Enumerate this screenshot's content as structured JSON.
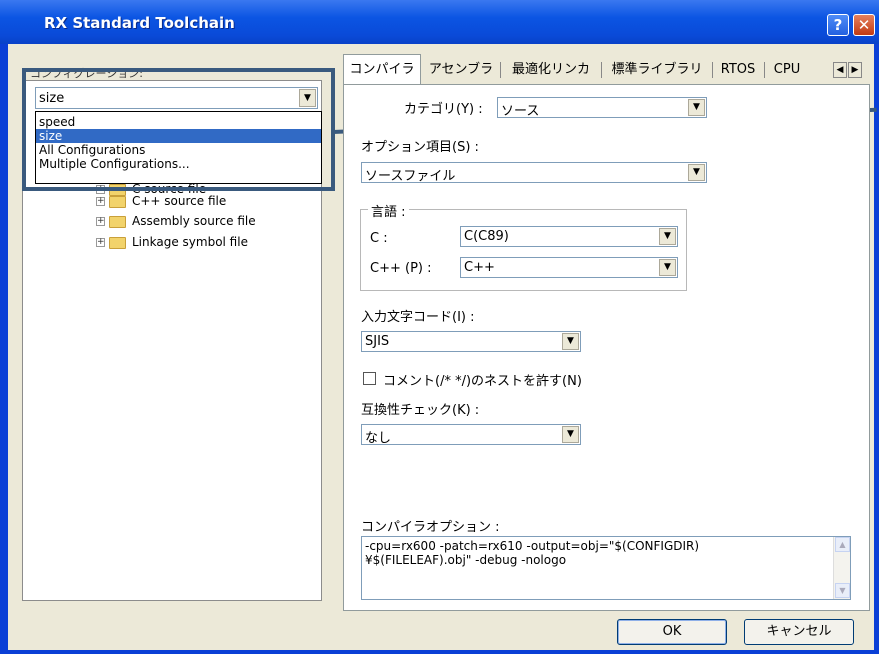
{
  "window": {
    "title": "RX Standard Toolchain",
    "help_glyph": "?",
    "close_glyph": "✕"
  },
  "left": {
    "config_label": "コンフィグレーション:",
    "config_selected": "size",
    "config_options": [
      {
        "label": "speed",
        "selected": false
      },
      {
        "label": "size",
        "selected": true
      },
      {
        "label": "All Configurations",
        "selected": false
      },
      {
        "label": "Multiple Configurations...",
        "selected": false
      }
    ],
    "tree_items": [
      {
        "label": "C source file",
        "expander": "+"
      },
      {
        "label": "C++ source file",
        "expander": "+"
      },
      {
        "label": "Assembly source file",
        "expander": "+"
      },
      {
        "label": "Linkage symbol file",
        "expander": "+"
      }
    ]
  },
  "tabs": [
    {
      "label": "コンパイラ",
      "active": true
    },
    {
      "label": "アセンブラ",
      "active": false
    },
    {
      "label": "最適化リンカ",
      "active": false
    },
    {
      "label": "標準ライブラリ",
      "active": false
    },
    {
      "label": "RTOS",
      "active": false
    },
    {
      "label": "CPU",
      "active": false
    }
  ],
  "tab_scroll": {
    "left": "◀",
    "right": "▶"
  },
  "compiler": {
    "category_label": "カテゴリ(Y) :",
    "category_value": "ソース",
    "option_item_label": "オプション項目(S) :",
    "option_item_value": "ソースファイル",
    "language_group": "言語 :",
    "c_label": "C :",
    "c_value": "C(C89)",
    "cpp_label": "C++ (P) :",
    "cpp_value": "C++",
    "charset_label": "入力文字コード(I) :",
    "charset_value": "SJIS",
    "nest_comment_label": "コメント(/* */)のネストを許す(N)",
    "nest_comment_checked": false,
    "compat_label": "互換性チェック(K) :",
    "compat_value": "なし",
    "options_label": "コンパイラオプション :",
    "options_text": "-cpu=rx600 -patch=rx610 -output=obj=\"$(CONFIGDIR)\n¥$(FILELEAF).obj\" -debug -nologo"
  },
  "buttons": {
    "ok": "OK",
    "cancel": "キャンセル"
  },
  "icons": {
    "dropdown": "▼",
    "scroll_up": "▲",
    "scroll_down": "▼"
  },
  "colors": {
    "title_bar": "#0b55e3",
    "selection": "#316ac5",
    "callout": "#3a5a7e"
  }
}
